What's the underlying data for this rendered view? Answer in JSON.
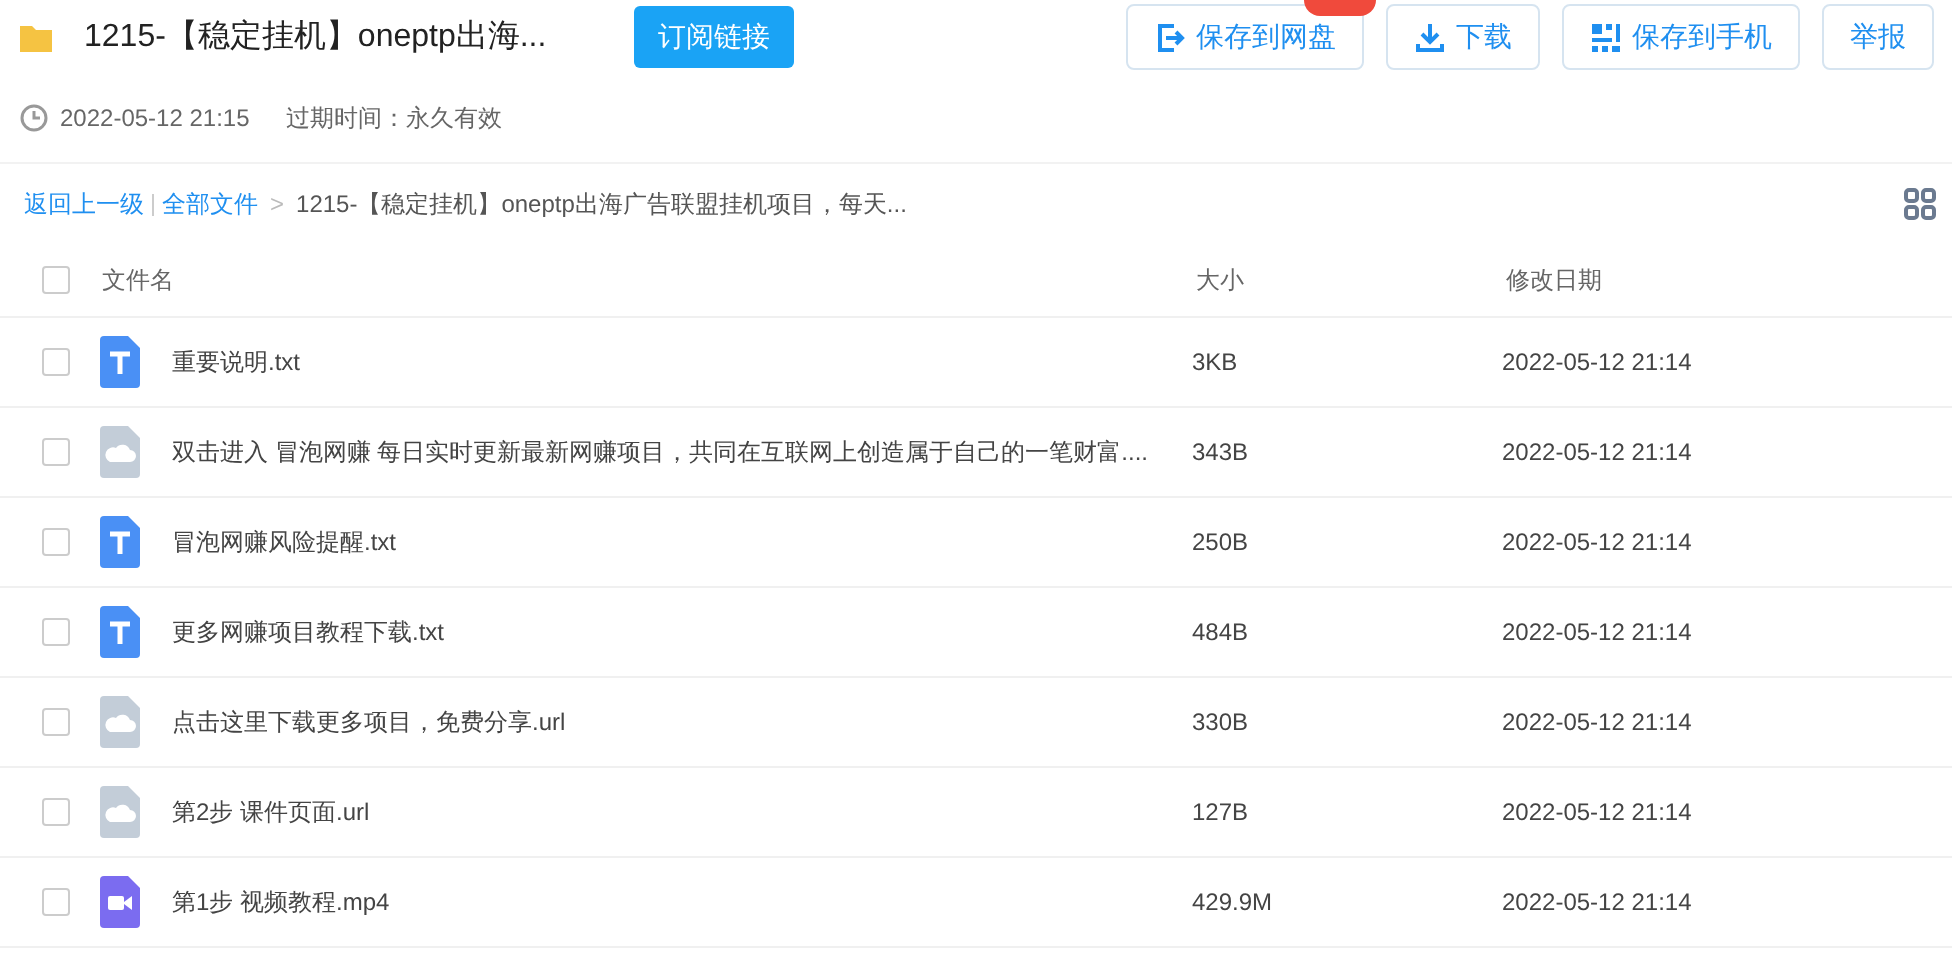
{
  "header": {
    "title": "1215-【稳定挂机】oneptp出海...",
    "subscribe": "订阅链接",
    "actions": [
      {
        "kind": "save",
        "label": "保存到网盘",
        "badge": true
      },
      {
        "kind": "download",
        "label": "下载",
        "badge": false
      },
      {
        "kind": "phone",
        "label": "保存到手机",
        "badge": false
      },
      {
        "kind": "report",
        "label": "举报",
        "badge": false
      }
    ]
  },
  "meta": {
    "time": "2022-05-12 21:15",
    "expiry": "过期时间：永久有效"
  },
  "breadcrumb": {
    "back": "返回上一级",
    "root": "全部文件",
    "separator": ">",
    "current": "1215-【稳定挂机】oneptp出海广告联盟挂机项目，每天..."
  },
  "table": {
    "columns": [
      "文件名",
      "大小",
      "修改日期"
    ],
    "all_checked": false,
    "rows": [
      {
        "kind": "txt",
        "name": "重要说明.txt",
        "size": "3KB",
        "date": "2022-05-12 21:14",
        "checked": false
      },
      {
        "kind": "url",
        "name": "双击进入 冒泡网赚 每日实时更新最新网赚项目，共同在互联网上创造属于自己的一笔财富....",
        "size": "343B",
        "date": "2022-05-12 21:14",
        "checked": false
      },
      {
        "kind": "txt",
        "name": "冒泡网赚风险提醒.txt",
        "size": "250B",
        "date": "2022-05-12 21:14",
        "checked": false
      },
      {
        "kind": "txt",
        "name": "更多网赚项目教程下载.txt",
        "size": "484B",
        "date": "2022-05-12 21:14",
        "checked": false
      },
      {
        "kind": "url",
        "name": "点击这里下载更多项目，免费分享.url",
        "size": "330B",
        "date": "2022-05-12 21:14",
        "checked": false
      },
      {
        "kind": "url",
        "name": "第2步 课件页面.url",
        "size": "127B",
        "date": "2022-05-12 21:14",
        "checked": false
      },
      {
        "kind": "video",
        "name": "第1步 视频教程.mp4",
        "size": "429.9M",
        "date": "2022-05-12 21:14",
        "checked": false
      }
    ]
  }
}
